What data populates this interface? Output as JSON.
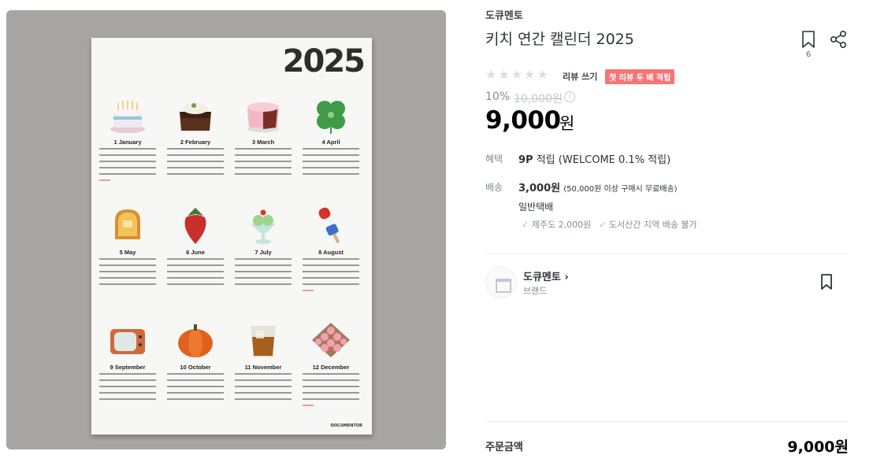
{
  "product": {
    "brand": "도큐멘토",
    "title": "키치 연간 캘린더 2025",
    "bookmark_count": "6",
    "rating_stars": 0,
    "review_link": "리뷰 쓰기",
    "review_badge": "첫 리뷰 두 배 적립",
    "discount": "10%",
    "original_price": "10,000원",
    "price": "9,000",
    "price_unit": "원"
  },
  "benefit": {
    "label": "혜택",
    "points": "9P",
    "points_suffix": " 적립 (WELCOME 0.1% 적립)"
  },
  "shipping": {
    "label": "배송",
    "fee": "3,000원",
    "fee_note": "(50,000원 이상 구매시 무료배송)",
    "type": "일반택배",
    "notes": [
      "제주도 2,000원",
      "도서산간 지역 배송 불가"
    ]
  },
  "store": {
    "name": "도큐멘토 ›",
    "subtitle": "브랜드"
  },
  "order": {
    "label": "주문금액",
    "total": "9,000원"
  },
  "poster": {
    "year": "2025",
    "months": [
      "1 January",
      "2 February",
      "3 March",
      "4 April",
      "5 May",
      "6 June",
      "7 July",
      "8 August",
      "9 September",
      "10 October",
      "11 November",
      "12 December"
    ],
    "brand": "DOCUMENTOR"
  },
  "icons": {
    "bookmark": "bookmark-icon",
    "share": "share-icon",
    "info": "info-icon",
    "star": "star-icon",
    "check": "check-icon",
    "store": "store-icon"
  },
  "colors": {
    "badge": "#f77575",
    "star_empty": "#dadde0",
    "muted": "#828c94"
  }
}
